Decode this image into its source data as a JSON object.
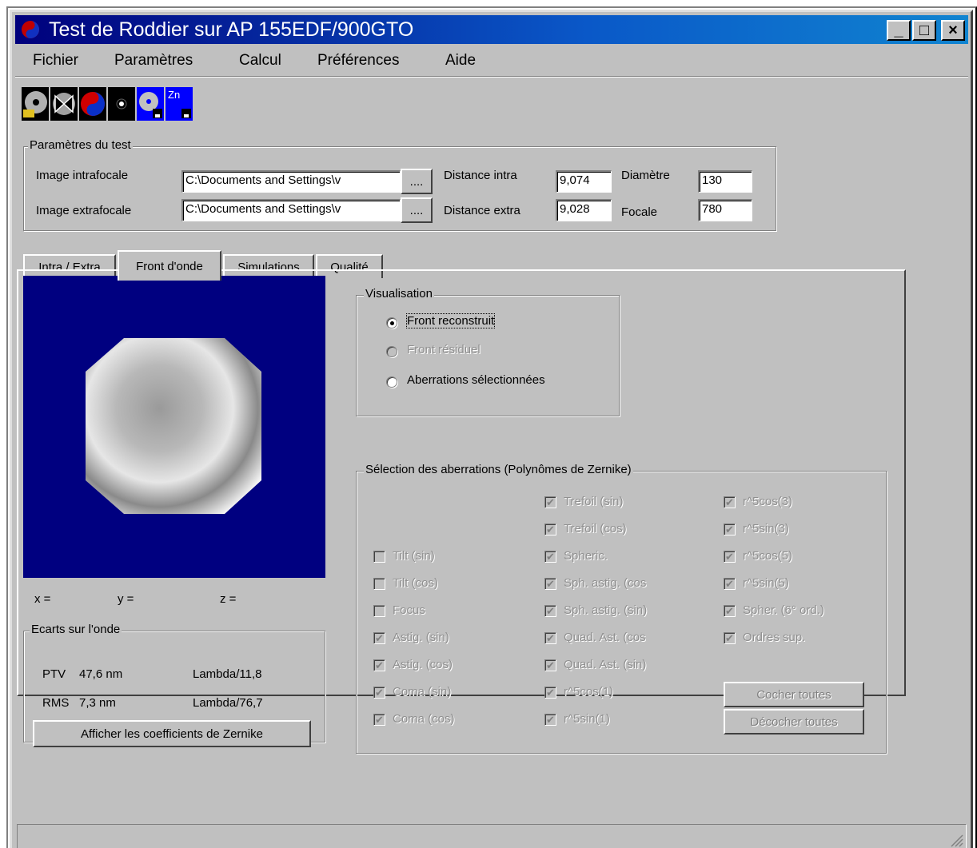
{
  "window": {
    "title": "Test de Roddier sur AP 155EDF/900GTO",
    "minimize": "_",
    "maximize": "□",
    "close": "×"
  },
  "menu": [
    "Fichier",
    "Paramètres",
    "Calcul",
    "Préférences",
    "Aide"
  ],
  "toolbar": {
    "buttons": [
      "open-disc-icon",
      "bowtie-icon",
      "yin-yang-icon",
      "dot-icon",
      "save-disc-icon",
      "save-zernike-icon"
    ],
    "zn_label": "Zn"
  },
  "params": {
    "group_label": "Paramètres du test",
    "intra_label": "Image intrafocale",
    "intra_value": "C:\\Documents and Settings\\v",
    "extra_label": "Image extrafocale",
    "extra_value": "C:\\Documents and Settings\\v",
    "browse_label": "....",
    "dist_intra_label": "Distance intra",
    "dist_intra_value": "9,074",
    "dist_extra_label": "Distance extra",
    "dist_extra_value": "9,028",
    "diametre_label": "Diamètre",
    "diametre_value": "130",
    "focale_label": "Focale",
    "focale_value": "780"
  },
  "tabs": [
    "Intra / Extra",
    "Front d'onde",
    "Simulations",
    "Qualité"
  ],
  "coords": {
    "x": "x =",
    "y": "y =",
    "z": "z ="
  },
  "ecarts": {
    "group_label": "Ecarts sur l'onde",
    "ptv_label": "PTV",
    "ptv_value": "47,6 nm",
    "ptv_lambda": "Lambda/11,8",
    "rms_label": "RMS",
    "rms_value": "7,3 nm",
    "rms_lambda": "Lambda/76,7",
    "zernike_button": "Afficher les coefficients de Zernike"
  },
  "visualisation": {
    "group_label": "Visualisation",
    "options": [
      {
        "label": "Front reconstruit",
        "selected": true,
        "enabled": true
      },
      {
        "label": "Front résiduel",
        "selected": false,
        "enabled": false
      },
      {
        "label": "Aberrations sélectionnées",
        "selected": false,
        "enabled": true
      }
    ]
  },
  "selection": {
    "group_label": "Sélection des aberrations (Polynômes de Zernike)",
    "col1": [
      {
        "label": "Tilt (sin)",
        "checked": false
      },
      {
        "label": "Tilt (cos)",
        "checked": false
      },
      {
        "label": "Focus",
        "checked": false
      },
      {
        "label": "Astig. (sin)",
        "checked": true
      },
      {
        "label": "Astig. (cos)",
        "checked": true
      },
      {
        "label": "Coma (sin)",
        "checked": true
      },
      {
        "label": "Coma (cos)",
        "checked": true
      }
    ],
    "col2": [
      {
        "label": "Trefoil (sin)",
        "checked": true
      },
      {
        "label": "Trefoil (cos)",
        "checked": true
      },
      {
        "label": "Spheric.",
        "checked": true
      },
      {
        "label": "Sph. astig. (cos",
        "checked": true
      },
      {
        "label": "Sph. astig. (sin)",
        "checked": true
      },
      {
        "label": "Quad. Ast. (cos",
        "checked": true
      },
      {
        "label": "Quad. Ast. (sin)",
        "checked": true
      },
      {
        "label": "r^5cos(1)",
        "checked": true
      },
      {
        "label": "r^5sin(1)",
        "checked": true
      }
    ],
    "col3": [
      {
        "label": "r^5cos(3)",
        "checked": true
      },
      {
        "label": "r^5sin(3)",
        "checked": true
      },
      {
        "label": "r^5cos(5)",
        "checked": true
      },
      {
        "label": "r^5sin(5)",
        "checked": true
      },
      {
        "label": "Spher. (6° ord.)",
        "checked": true
      },
      {
        "label": "Ordres sup.",
        "checked": true
      }
    ],
    "check_all": "Cocher toutes",
    "uncheck_all": "Décocher toutes"
  }
}
